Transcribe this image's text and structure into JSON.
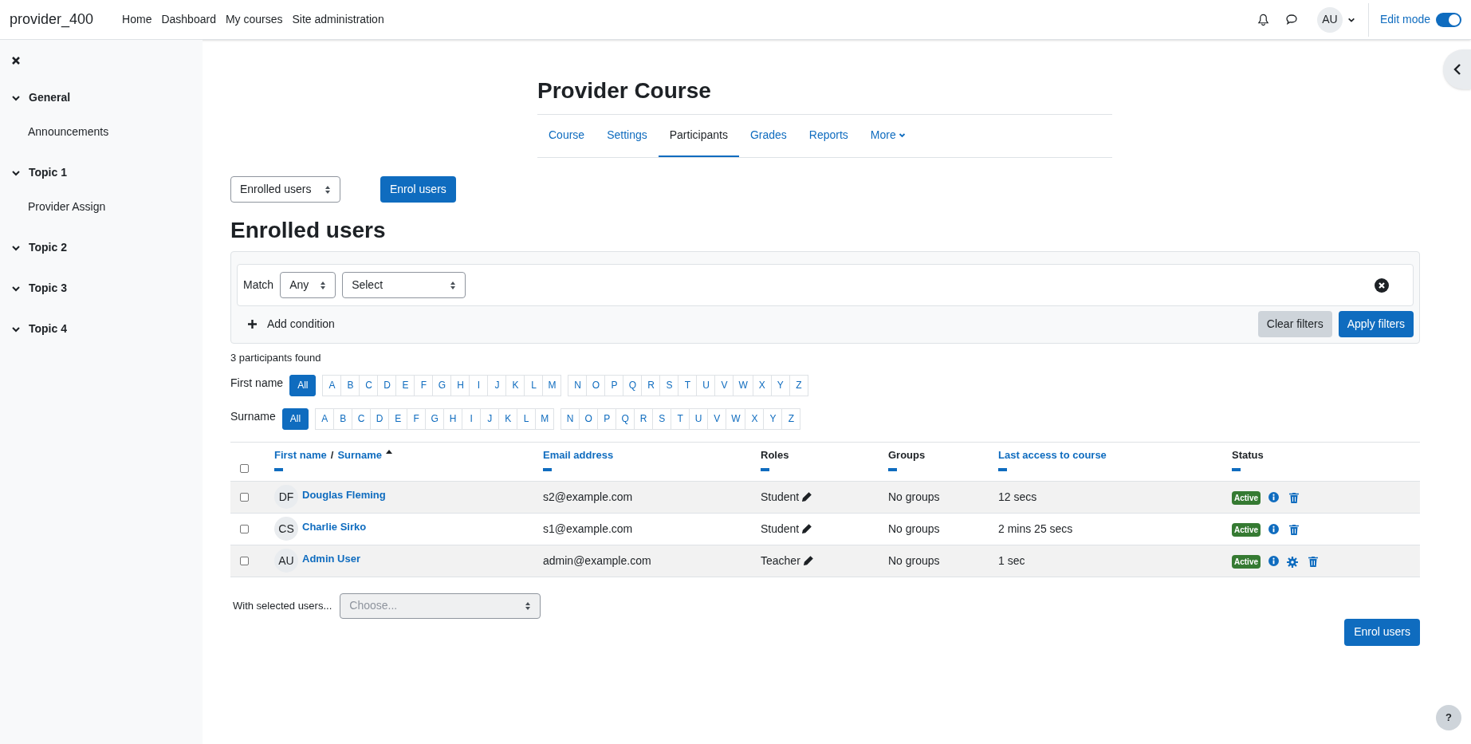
{
  "site_name": "provider_400",
  "nav": [
    "Home",
    "Dashboard",
    "My courses",
    "Site administration"
  ],
  "user_initials": "AU",
  "edit_mode": {
    "label": "Edit mode",
    "on": true
  },
  "sidebar": {
    "sections": [
      {
        "title": "General",
        "expanded": true,
        "children": [
          "Announcements"
        ]
      },
      {
        "title": "Topic 1",
        "expanded": true,
        "children": [
          "Provider Assign"
        ]
      },
      {
        "title": "Topic 2",
        "expanded": true
      },
      {
        "title": "Topic 3",
        "expanded": true
      },
      {
        "title": "Topic 4",
        "expanded": true
      }
    ]
  },
  "course_title": "Provider Course",
  "tabs": [
    {
      "label": "Course",
      "selected": false,
      "kind": "link"
    },
    {
      "label": "Settings",
      "selected": false,
      "kind": "link"
    },
    {
      "label": "Participants",
      "selected": true,
      "kind": "link"
    },
    {
      "label": "Grades",
      "selected": false,
      "kind": "link"
    },
    {
      "label": "Reports",
      "selected": false,
      "kind": "link"
    },
    {
      "label": "More",
      "selected": false,
      "kind": "menu"
    }
  ],
  "view_select": {
    "value": "Enrolled users"
  },
  "enrol_button": "Enrol users",
  "heading": "Enrolled users",
  "filter": {
    "match_label": "Match",
    "match_value": "Any",
    "condition_value": "Select",
    "add_condition": "Add condition",
    "clear": "Clear filters",
    "apply": "Apply filters"
  },
  "found": "3 participants found",
  "initials_bars": [
    {
      "label": "First name",
      "all": {
        "label": "All",
        "selected": true
      },
      "letters": [
        [
          "A",
          "B",
          "C",
          "D",
          "E",
          "F",
          "G",
          "H",
          "I",
          "J",
          "K",
          "L",
          "M"
        ],
        [
          "N",
          "O",
          "P",
          "Q",
          "R",
          "S",
          "T",
          "U",
          "V",
          "W",
          "X",
          "Y",
          "Z"
        ]
      ]
    },
    {
      "label": "Surname",
      "all": {
        "label": "All",
        "selected": true
      },
      "letters": [
        [
          "A",
          "B",
          "C",
          "D",
          "E",
          "F",
          "G",
          "H",
          "I",
          "J",
          "K",
          "L",
          "M"
        ],
        [
          "N",
          "O",
          "P",
          "Q",
          "R",
          "S",
          "T",
          "U",
          "V",
          "W",
          "X",
          "Y",
          "Z"
        ]
      ]
    }
  ],
  "table": {
    "select_all_checked": false,
    "columns": [
      {
        "label": "First name",
        "separator": "/",
        "label2": "Surname",
        "sortable": true,
        "sorted": true
      },
      {
        "label": "Email address",
        "sortable": true,
        "sorted": false
      },
      {
        "label": "Roles",
        "sortable": false,
        "sorted": false
      },
      {
        "label": "Groups",
        "sortable": false,
        "sorted": false
      },
      {
        "label": "Last access to course",
        "sortable": true,
        "sorted": false
      },
      {
        "label": "Status",
        "sortable": false,
        "sorted": false
      }
    ],
    "rows": [
      {
        "checked": false,
        "initials": "DF",
        "name": "Douglas Fleming",
        "email": "s2@example.com",
        "role": "Student",
        "groups": "No groups",
        "last_access": "12 secs",
        "status": "Active",
        "actions": [
          {
            "kind": "info"
          },
          {
            "kind": "delete"
          }
        ]
      },
      {
        "checked": false,
        "initials": "CS",
        "name": "Charlie Sirko",
        "email": "s1@example.com",
        "role": "Student",
        "groups": "No groups",
        "last_access": "2 mins 25 secs",
        "status": "Active",
        "actions": [
          {
            "kind": "info"
          },
          {
            "kind": "delete"
          }
        ]
      },
      {
        "checked": false,
        "initials": "AU",
        "name": "Admin User",
        "email": "admin@example.com",
        "role": "Teacher",
        "groups": "No groups",
        "last_access": "1 sec",
        "status": "Active",
        "actions": [
          {
            "kind": "info"
          },
          {
            "kind": "settings"
          },
          {
            "kind": "delete"
          }
        ]
      }
    ]
  },
  "bulk": {
    "label": "With selected users...",
    "placeholder": "Choose...",
    "disabled": true
  },
  "bottom_enrol_button": "Enrol users",
  "help": "?"
}
